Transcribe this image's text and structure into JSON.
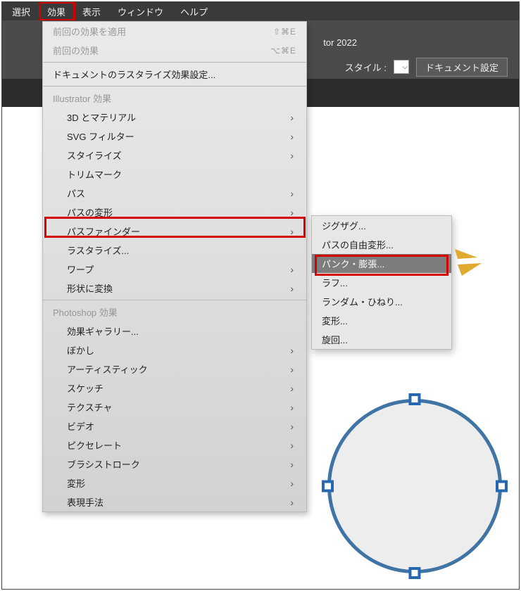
{
  "menubar": {
    "items": [
      "選択",
      "効果",
      "表示",
      "ウィンドウ",
      "ヘルプ"
    ]
  },
  "title_suffix": "tor 2022",
  "controlbar": {
    "style_label": "スタイル :",
    "docset_button": "ドキュメント設定"
  },
  "dropdown": {
    "apply_last": "前回の効果を適用",
    "apply_last_short": "⇧⌘E",
    "last_effect": "前回の効果",
    "last_effect_short": "⌥⌘E",
    "raster_settings": "ドキュメントのラスタライズ効果設定...",
    "section_ill": "Illustrator 効果",
    "ill_items": [
      {
        "label": "3D とマテリアル",
        "sub": true
      },
      {
        "label": "SVG フィルター",
        "sub": true
      },
      {
        "label": "スタイライズ",
        "sub": true
      },
      {
        "label": "トリムマーク",
        "sub": false
      },
      {
        "label": "パス",
        "sub": true
      },
      {
        "label": "パスの変形",
        "sub": true
      },
      {
        "label": "パスファインダー",
        "sub": true
      },
      {
        "label": "ラスタライズ...",
        "sub": false
      },
      {
        "label": "ワープ",
        "sub": true
      },
      {
        "label": "形状に変換",
        "sub": true
      }
    ],
    "section_ps": "Photoshop 効果",
    "ps_items": [
      {
        "label": "効果ギャラリー...",
        "sub": false
      },
      {
        "label": "ぼかし",
        "sub": true
      },
      {
        "label": "アーティスティック",
        "sub": true
      },
      {
        "label": "スケッチ",
        "sub": true
      },
      {
        "label": "テクスチャ",
        "sub": true
      },
      {
        "label": "ビデオ",
        "sub": true
      },
      {
        "label": "ピクセレート",
        "sub": true
      },
      {
        "label": "ブラシストローク",
        "sub": true
      },
      {
        "label": "変形",
        "sub": true
      },
      {
        "label": "表現手法",
        "sub": true
      }
    ]
  },
  "submenu": {
    "items": [
      "ジグザグ...",
      "パスの自由変形...",
      "パンク・膨張...",
      "ラフ...",
      "ランダム・ひねり...",
      "変形...",
      "旋回..."
    ],
    "selected_index": 2
  }
}
